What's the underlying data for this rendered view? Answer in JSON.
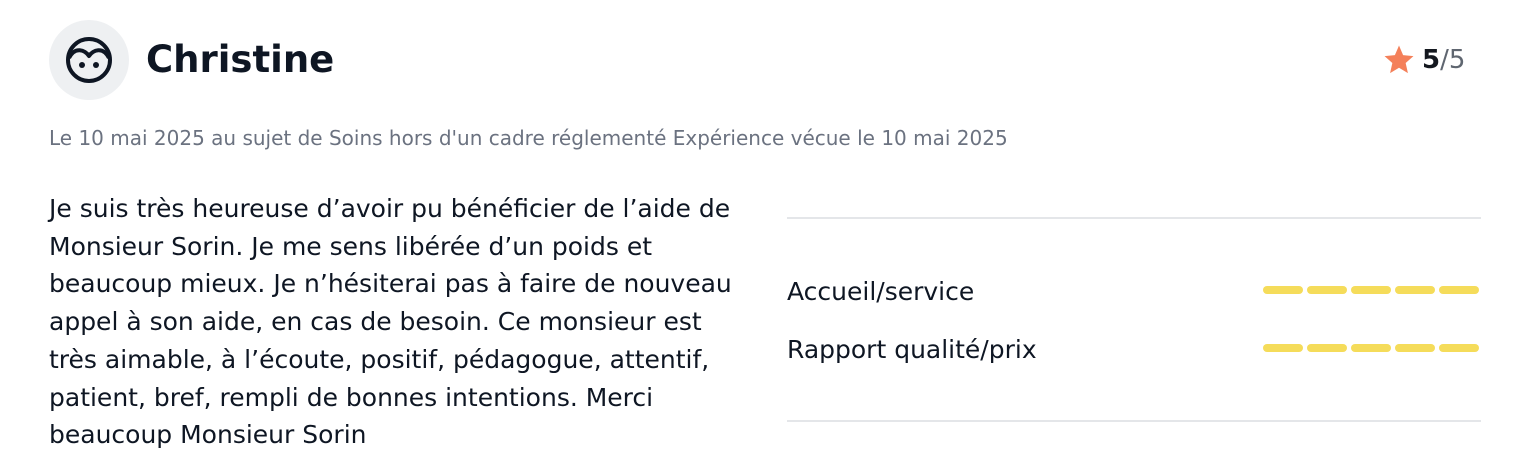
{
  "review": {
    "reviewer_name": "Christine",
    "avatar_icon": "user-face-icon",
    "rating": {
      "score": "5",
      "separator": "/",
      "max": "5",
      "star_icon": "star-icon",
      "star_color": "#f4805a"
    },
    "meta": "Le 10 mai 2025 au sujet de Soins hors d'un cadre réglementé Expérience vécue le 10 mai 2025",
    "text": "Je suis très heureuse d’avoir pu bénéficier de l’aide de Monsieur Sorin. Je me sens libérée d’un poids et beaucoup mieux. Je n’hésiterai pas à faire de nouveau appel à son aide, en cas de besoin. Ce monsieur est très aimable, à l’écoute, positif, pédagogue, attentif, patient, bref, rempli de bonnes intentions. Merci beaucoup Monsieur Sorin",
    "criteria": [
      {
        "label": "Accueil/service",
        "score": 5,
        "max": 5
      },
      {
        "label": "Rapport qualité/prix",
        "score": 5,
        "max": 5
      }
    ],
    "bar_color_filled": "#f5dc5a",
    "bar_color_empty": "#e8e9ec"
  }
}
